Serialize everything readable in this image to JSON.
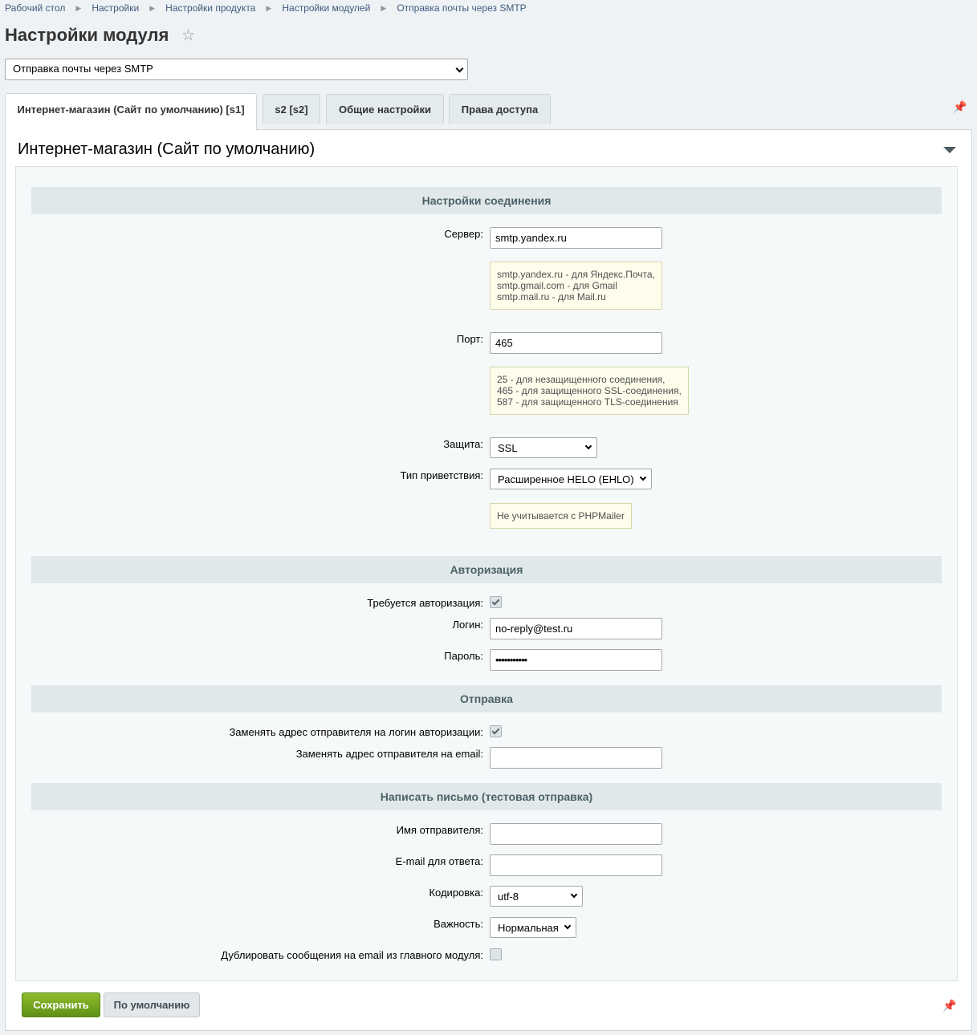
{
  "breadcrumb": [
    "Рабочий стол",
    "Настройки",
    "Настройки продукта",
    "Настройки модулей",
    "Отправка почты через SMTP"
  ],
  "page_title": "Настройки модуля",
  "module_select": "Отправка почты через SMTP",
  "tabs": [
    {
      "label": "Интернет-магазин (Сайт по умолчанию) [s1]",
      "active": true
    },
    {
      "label": "s2 [s2]",
      "active": false
    },
    {
      "label": "Общие настройки",
      "active": false
    },
    {
      "label": "Права доступа",
      "active": false
    }
  ],
  "panel_title": "Интернет-магазин (Сайт по умолчанию)",
  "sections": {
    "connection": "Настройки соединения",
    "auth": "Авторизация",
    "sending": "Отправка",
    "test": "Написать письмо (тестовая отправка)"
  },
  "fields": {
    "server": {
      "label": "Сервер:",
      "value": "smtp.yandex.ru",
      "hint": [
        "smtp.yandex.ru - для Яндекс.Почта,",
        "smtp.gmail.com - для Gmail",
        "smtp.mail.ru - для Mail.ru"
      ]
    },
    "port": {
      "label": "Порт:",
      "value": "465",
      "hint": [
        "25 - для незащищенного соединения,",
        "465 - для защищенного SSL-соединения,",
        "587 - для защищенного TLS-соединения"
      ]
    },
    "security": {
      "label": "Защита:",
      "value": "SSL"
    },
    "greeting": {
      "label": "Тип приветствия:",
      "value": "Расширенное HELO (EHLO)",
      "hint": "Не учитывается с PHPMailer"
    },
    "auth_required": {
      "label": "Требуется авторизация:",
      "checked": true
    },
    "login": {
      "label": "Логин:",
      "value": "no-reply@test.ru"
    },
    "password": {
      "label": "Пароль:",
      "value": "•••••••••••"
    },
    "replace_sender_login": {
      "label": "Заменять адрес отправителя на логин авторизации:",
      "checked": true
    },
    "replace_sender_email": {
      "label": "Заменять адрес отправителя на email:",
      "value": ""
    },
    "sender_name": {
      "label": "Имя отправителя:",
      "value": ""
    },
    "reply_email": {
      "label": "E-mail для ответа:",
      "value": ""
    },
    "encoding": {
      "label": "Кодировка:",
      "value": "utf-8"
    },
    "priority": {
      "label": "Важность:",
      "value": "Нормальная"
    },
    "duplicate": {
      "label": "Дублировать сообщения на email из главного модуля:",
      "checked": false
    }
  },
  "buttons": {
    "save": "Сохранить",
    "default": "По умолчанию"
  },
  "icons": {
    "star": "star-icon",
    "pin": "pin-icon",
    "collapse": "collapse-triangle-icon"
  }
}
